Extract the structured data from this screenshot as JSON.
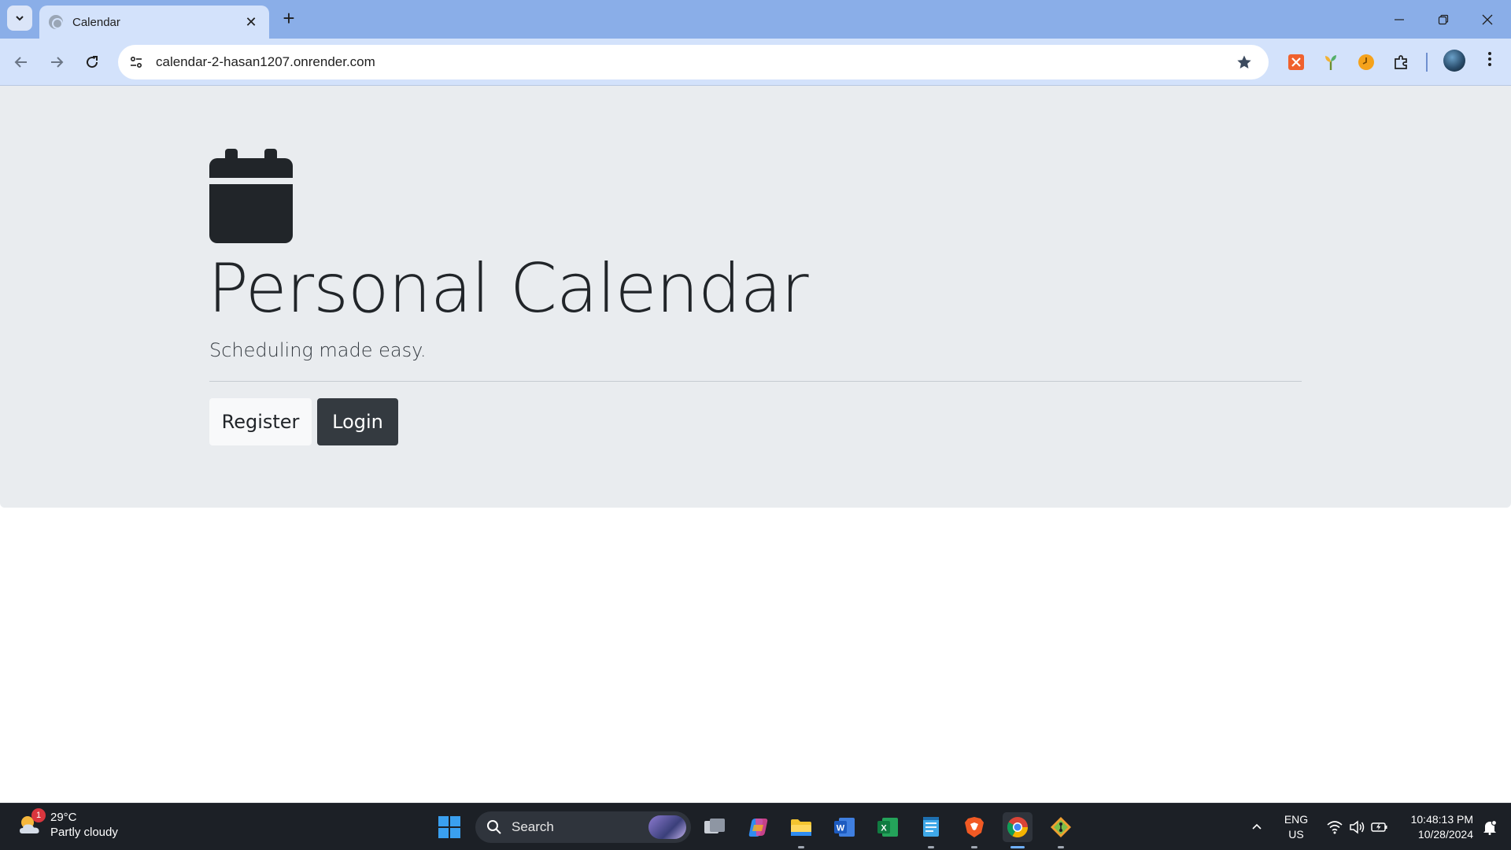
{
  "browser": {
    "tab_title": "Calendar",
    "url": "calendar-2-hasan1207.onrender.com",
    "icons": [
      "tab-list-icon",
      "globe-icon",
      "close-icon",
      "plus-icon",
      "minimize-icon",
      "restore-icon",
      "close-window-icon",
      "back-icon",
      "forward-icon",
      "reload-icon",
      "site-info-icon",
      "star-icon",
      "extensions-icon",
      "more-icon"
    ]
  },
  "page": {
    "title": "Personal Calendar",
    "lead": "Scheduling made easy.",
    "register_label": "Register",
    "login_label": "Login",
    "colors": {
      "jumbotron_bg": "#e9ecef",
      "text_dark": "#212529",
      "button_dark": "#343a40",
      "button_light": "#f8f9fa"
    }
  },
  "taskbar": {
    "temperature": "29°C",
    "condition": "Partly cloudy",
    "weather_badge": "1",
    "search_label": "Search",
    "lang_top": "ENG",
    "lang_bottom": "US",
    "time": "10:48:13 PM",
    "date": "10/28/2024",
    "apps": [
      "windows-start",
      "task-view",
      "copilot",
      "file-explorer",
      "word",
      "excel",
      "notepad",
      "brave",
      "chrome",
      "git"
    ]
  }
}
